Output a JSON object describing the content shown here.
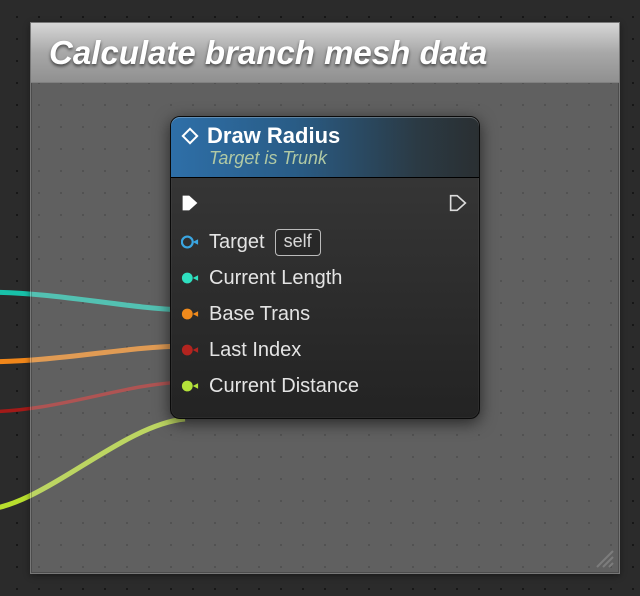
{
  "comment": {
    "title": "Calculate branch mesh data"
  },
  "node": {
    "title": "Draw Radius",
    "subtitle": "Target is Trunk",
    "pins": [
      {
        "label": "Target",
        "value": "self",
        "color": "#3aa6e2",
        "filled": false,
        "show_value": true
      },
      {
        "label": "Current Length",
        "color": "#2fe0c0",
        "filled": true,
        "show_value": false
      },
      {
        "label": "Base Trans",
        "color": "#f08a1c",
        "filled": true,
        "show_value": false
      },
      {
        "label": "Last Index",
        "color": "#b3241f",
        "filled": true,
        "show_value": false
      },
      {
        "label": "Current Distance",
        "color": "#b4e23a",
        "filled": true,
        "show_value": false
      }
    ]
  },
  "colors": {
    "wire_teal": "#18c1a9",
    "wire_orange": "#f0861a",
    "wire_red": "#b11f1c",
    "wire_lime": "#b8df2e"
  }
}
